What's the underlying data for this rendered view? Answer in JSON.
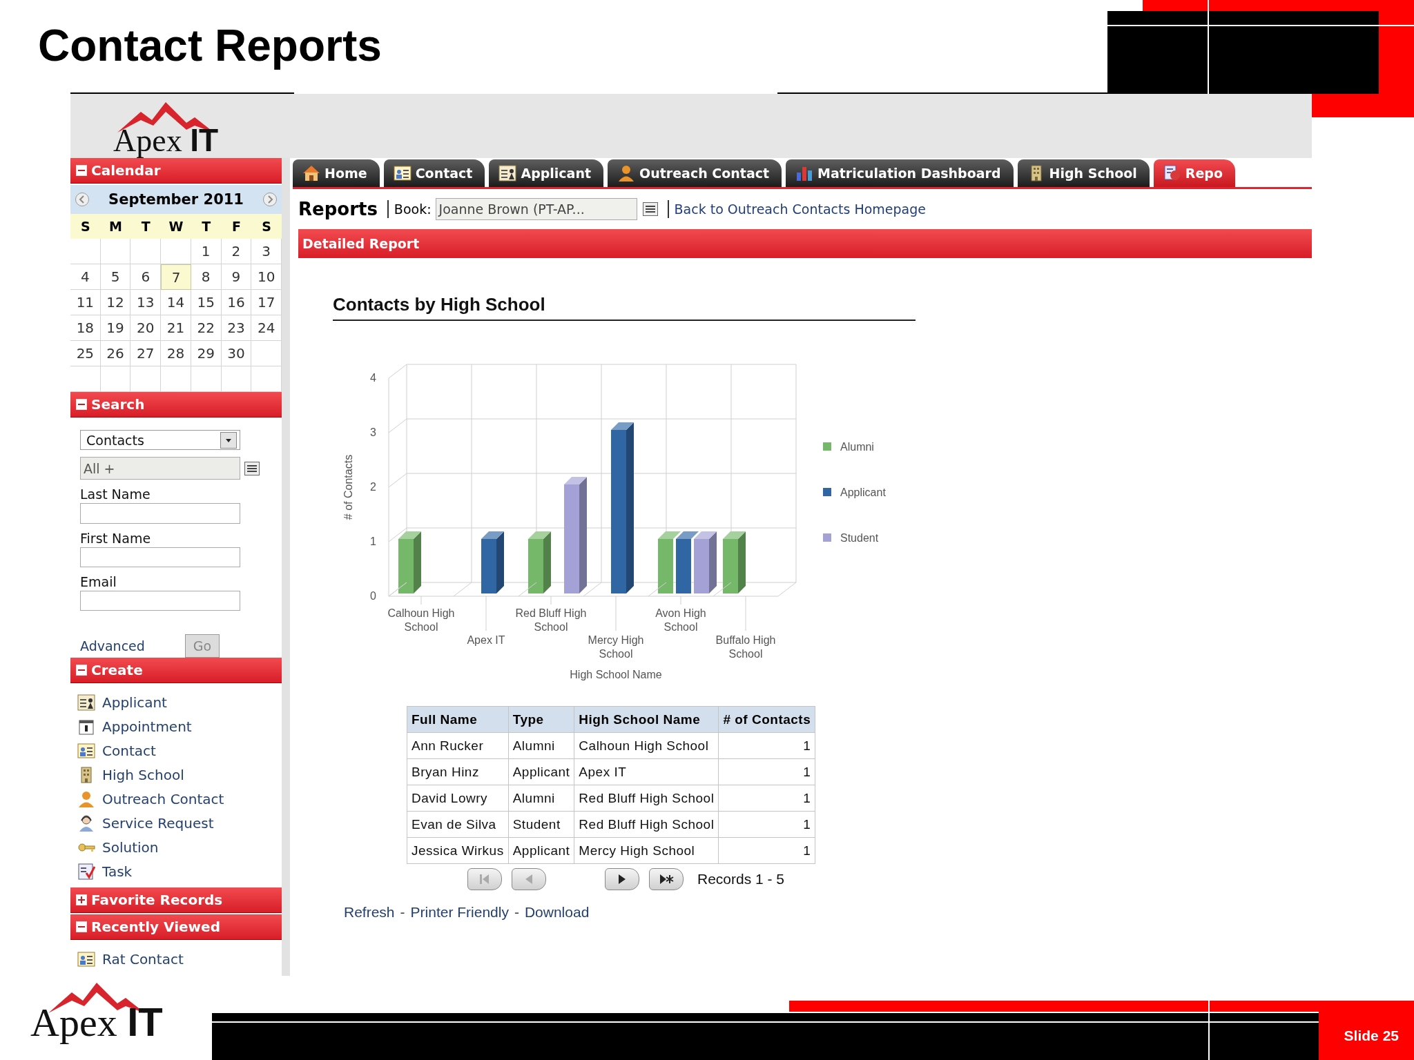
{
  "slide": {
    "title": "Contact Reports",
    "number": "Slide 25"
  },
  "logo": {
    "text": "Apex **IT**"
  },
  "tabs": [
    {
      "label": "Home",
      "kind": "home",
      "selected": false
    },
    {
      "label": "Contact",
      "kind": "contact",
      "selected": false
    },
    {
      "label": "Applicant",
      "kind": "applicant",
      "selected": false
    },
    {
      "label": "Outreach Contact",
      "kind": "outreach",
      "selected": false
    },
    {
      "label": "Matriculation Dashboard",
      "kind": "dashboard",
      "selected": false
    },
    {
      "label": "High School",
      "kind": "highschool",
      "selected": false
    },
    {
      "label": "Repo",
      "kind": "reports",
      "selected": true
    }
  ],
  "sidebar": {
    "panels": [
      {
        "kind": "calendar",
        "title": "Calendar",
        "expanded": true,
        "month": "September 2011",
        "weekdays": [
          "S",
          "M",
          "T",
          "W",
          "T",
          "F",
          "S"
        ],
        "weeks": [
          [
            {
              "kind": "blank"
            },
            {
              "kind": "blank"
            },
            {
              "kind": "blank"
            },
            {
              "kind": "blank"
            },
            {
              "kind": "day",
              "day": "1",
              "selected": false
            },
            {
              "kind": "day",
              "day": "2",
              "selected": false
            },
            {
              "kind": "day",
              "day": "3",
              "selected": false
            }
          ],
          [
            {
              "kind": "day",
              "day": "4",
              "selected": false
            },
            {
              "kind": "day",
              "day": "5",
              "selected": false
            },
            {
              "kind": "day",
              "day": "6",
              "selected": false
            },
            {
              "kind": "day",
              "day": "7",
              "selected": true
            },
            {
              "kind": "day",
              "day": "8",
              "selected": false
            },
            {
              "kind": "day",
              "day": "9",
              "selected": false
            },
            {
              "kind": "day",
              "day": "10",
              "selected": false
            }
          ],
          [
            {
              "kind": "day",
              "day": "11",
              "selected": false
            },
            {
              "kind": "day",
              "day": "12",
              "selected": false
            },
            {
              "kind": "day",
              "day": "13",
              "selected": false
            },
            {
              "kind": "day",
              "day": "14",
              "selected": false
            },
            {
              "kind": "day",
              "day": "15",
              "selected": false
            },
            {
              "kind": "day",
              "day": "16",
              "selected": false
            },
            {
              "kind": "day",
              "day": "17",
              "selected": false
            }
          ],
          [
            {
              "kind": "day",
              "day": "18",
              "selected": false
            },
            {
              "kind": "day",
              "day": "19",
              "selected": false
            },
            {
              "kind": "day",
              "day": "20",
              "selected": false
            },
            {
              "kind": "day",
              "day": "21",
              "selected": false
            },
            {
              "kind": "day",
              "day": "22",
              "selected": false
            },
            {
              "kind": "day",
              "day": "23",
              "selected": false
            },
            {
              "kind": "day",
              "day": "24",
              "selected": false
            }
          ],
          [
            {
              "kind": "day",
              "day": "25",
              "selected": false
            },
            {
              "kind": "day",
              "day": "26",
              "selected": false
            },
            {
              "kind": "day",
              "day": "27",
              "selected": false
            },
            {
              "kind": "day",
              "day": "28",
              "selected": false
            },
            {
              "kind": "day",
              "day": "29",
              "selected": false
            },
            {
              "kind": "day",
              "day": "30",
              "selected": false
            },
            {
              "kind": "blank"
            }
          ],
          [
            {
              "kind": "blank"
            },
            {
              "kind": "blank"
            },
            {
              "kind": "blank"
            },
            {
              "kind": "blank"
            },
            {
              "kind": "blank"
            },
            {
              "kind": "blank"
            },
            {
              "kind": "blank"
            }
          ]
        ]
      },
      {
        "kind": "search",
        "title": "Search",
        "expanded": true,
        "type": "Contacts",
        "filter": "All +",
        "fields": [
          {
            "label": "Last Name"
          },
          {
            "label": "First Name"
          },
          {
            "label": "Email"
          }
        ],
        "advanced": "Advanced",
        "go": "Go"
      },
      {
        "kind": "list",
        "title": "Create",
        "expanded": true,
        "items": [
          {
            "label": "Applicant",
            "kind": "applicant"
          },
          {
            "label": "Appointment",
            "kind": "appointment"
          },
          {
            "label": "Contact",
            "kind": "contact"
          },
          {
            "label": "High School",
            "kind": "highschool"
          },
          {
            "label": "Outreach Contact",
            "kind": "outreach"
          },
          {
            "label": "Service Request",
            "kind": "service"
          },
          {
            "label": "Solution",
            "kind": "solution"
          },
          {
            "label": "Task",
            "kind": "task"
          }
        ]
      },
      {
        "kind": "list",
        "title": "Favorite Records",
        "expanded": false
      },
      {
        "kind": "list",
        "title": "Recently Viewed",
        "expanded": true,
        "items": [
          {
            "label": "Rat Contact",
            "kind": "contact"
          }
        ]
      }
    ]
  },
  "toolbar": {
    "title": "Reports",
    "book_label": "Book:",
    "book_value": "Joanne Brown (PT-AP...",
    "back_link": "Back to Outreach Contacts Homepage"
  },
  "report": {
    "section": "Detailed Report",
    "chart_data": {
      "type": "bar",
      "title": "Contacts by High School",
      "xlabel": "High School Name",
      "ylabel": "# of Contacts",
      "categories": [
        "Calhoun High School",
        "Apex IT",
        "Red Bluff High School",
        "Mercy High School",
        "Avon High School",
        "Buffalo High School"
      ],
      "series": [
        {
          "name": "Alumni",
          "color": "#76b86a",
          "values": [
            1,
            null,
            1,
            null,
            1,
            1
          ]
        },
        {
          "name": "Applicant",
          "color": "#2f66a3",
          "values": [
            null,
            1,
            null,
            3,
            1,
            null
          ]
        },
        {
          "name": "Student",
          "color": "#a3a1d6",
          "values": [
            null,
            null,
            2,
            null,
            1,
            null
          ]
        }
      ],
      "ylim": [
        0,
        4
      ],
      "yticks": [
        0,
        1,
        2,
        3,
        4
      ],
      "legend": "right"
    },
    "table": {
      "columns": [
        "Full Name",
        "Type",
        "High School Name",
        "# of Contacts"
      ],
      "rows": [
        [
          "Ann Rucker",
          "Alumni",
          "Calhoun High School",
          "1"
        ],
        [
          "Bryan Hinz",
          "Applicant",
          "Apex IT",
          "1"
        ],
        [
          "David Lowry",
          "Alumni",
          "Red Bluff High School",
          "1"
        ],
        [
          "Evan de Silva",
          "Student",
          "Red Bluff High School",
          "1"
        ],
        [
          "Jessica Wirkus",
          "Applicant",
          "Mercy High School",
          "1"
        ]
      ]
    },
    "pager": {
      "buttons": [
        {
          "kind": "first",
          "disabled": true
        },
        {
          "kind": "prev",
          "disabled": true
        },
        {
          "kind": "next",
          "disabled": false
        },
        {
          "kind": "last",
          "disabled": false
        }
      ],
      "records": "Records 1 - 5"
    },
    "links": [
      {
        "text": "Refresh",
        "kind": "link"
      },
      {
        "text": "-",
        "kind": "separator"
      },
      {
        "text": "Printer Friendly",
        "kind": "link"
      },
      {
        "text": "-",
        "kind": "separator"
      },
      {
        "text": "Download",
        "kind": "link"
      }
    ]
  },
  "footer_logo": {
    "text": "Apex **IT**"
  }
}
